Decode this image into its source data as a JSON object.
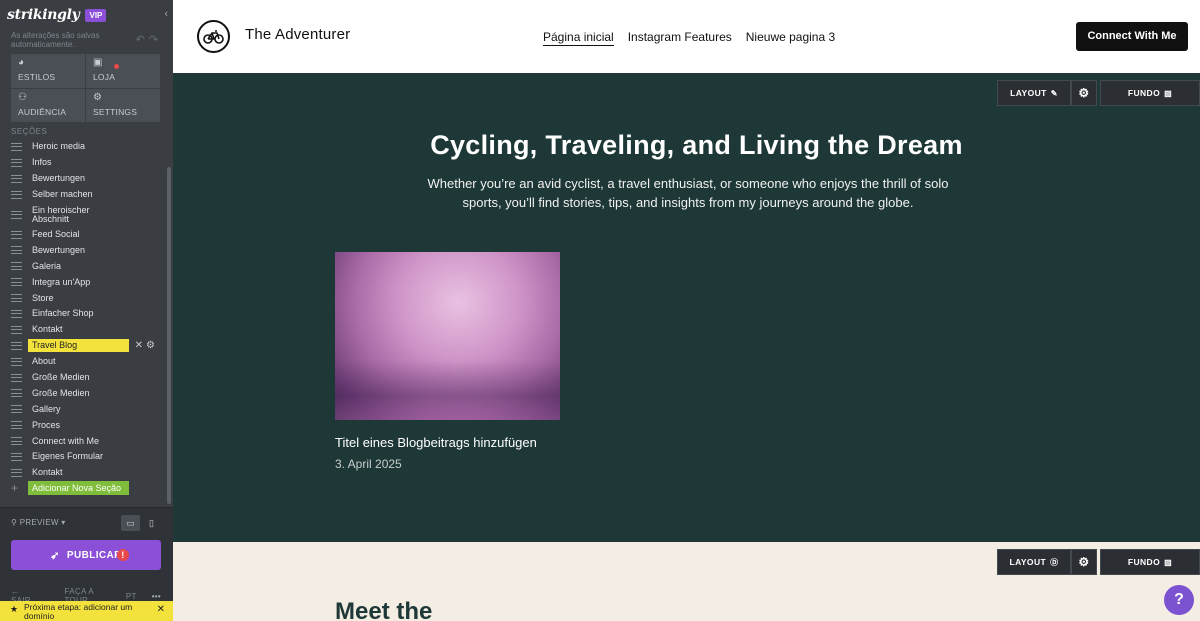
{
  "sidebar": {
    "logo": "strikingly",
    "vip_badge": "VIP",
    "autosave_text": "As alterações são salvas automaticamente.",
    "nav": [
      {
        "label": "ESTILOS",
        "icon": "palette-icon"
      },
      {
        "label": "LOJA",
        "icon": "bag-icon"
      },
      {
        "label": "AUDIÊNCIA",
        "icon": "people-icon"
      },
      {
        "label": "SETTINGS",
        "icon": "gear-icon"
      }
    ],
    "sections_heading": "SEÇÕES",
    "sections": [
      "Heroic media",
      "Infos",
      "Bewertungen",
      "Selber machen",
      "Ein heroischer Abschnitt",
      "Feed Social",
      "Bewertungen",
      "Galeria",
      "Integra un'App",
      "Store",
      "Einfacher Shop",
      "Kontakt",
      "Travel Blog",
      "About",
      "Große Medien",
      "Große Medien",
      "Gallery",
      "Proces",
      "Connect with Me",
      "Eigenes Formular",
      "Kontakt"
    ],
    "active_section_index": 12,
    "add_section_label": "Adicionar Nova Seção",
    "preview_label": "PREVIEW",
    "publish_label": "PUBLICAR",
    "footer": {
      "exit": "SAIR",
      "tour": "FAÇA A TOUR",
      "lang": "PT",
      "more": "•••"
    },
    "next_step": "Próxima etapa: adicionar um domínio"
  },
  "header": {
    "brand_name": "The Adventurer",
    "nav": [
      "Página inicial",
      "Instagram Features",
      "Nieuwe pagina 3"
    ],
    "cta": "Connect With Me"
  },
  "editor": {
    "layout_label": "LAYOUT",
    "fundo_label": "FUNDO"
  },
  "hero": {
    "title": "Cycling, Traveling, and Living the Dream",
    "subtitle": "Whether you’re an avid cyclist, a travel enthusiast, or someone who enjoys the thrill of solo sports, you’ll find stories, tips, and insights from my journeys around the globe.",
    "post": {
      "title": "Titel eines Blogbeitrags hinzufügen",
      "date": "3. April 2025"
    }
  },
  "next_section": {
    "heading": "Meet the"
  },
  "help": {
    "label": "?"
  }
}
